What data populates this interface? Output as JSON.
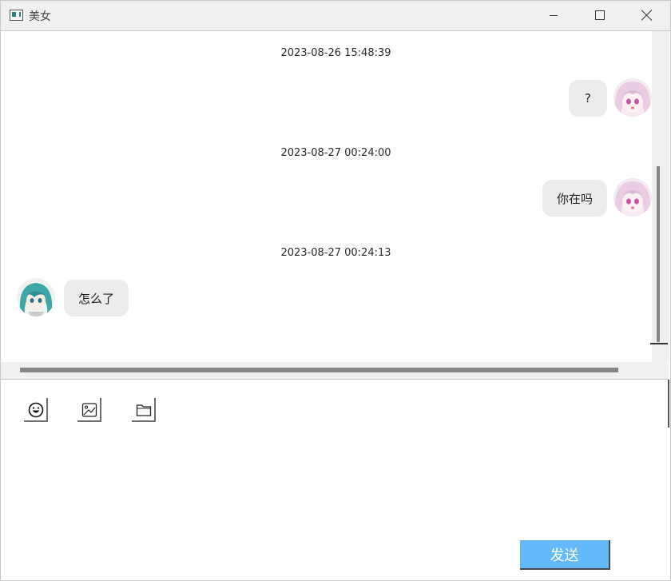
{
  "window": {
    "title": "美女",
    "icons": {
      "app": "app-window-icon",
      "minimize": "minimize-icon",
      "maximize": "maximize-icon",
      "close": "close-icon"
    }
  },
  "chat": {
    "messages": [
      {
        "timestamp": "2023-08-26 15:48:39",
        "sender": "self",
        "text": "?"
      },
      {
        "timestamp": "2023-08-27 00:24:00",
        "sender": "self",
        "text": "你在吗"
      },
      {
        "timestamp": "2023-08-27 00:24:13",
        "sender": "other",
        "text": "怎么了"
      }
    ]
  },
  "toolbar": {
    "icons": [
      "emoji-icon",
      "image-icon",
      "folder-icon"
    ]
  },
  "composer": {
    "value": "",
    "placeholder": ""
  },
  "send": {
    "label": "发送"
  },
  "colors": {
    "send_button": "#63b8fa",
    "bubble": "#ececec",
    "titlebar": "#f0f0f0"
  }
}
